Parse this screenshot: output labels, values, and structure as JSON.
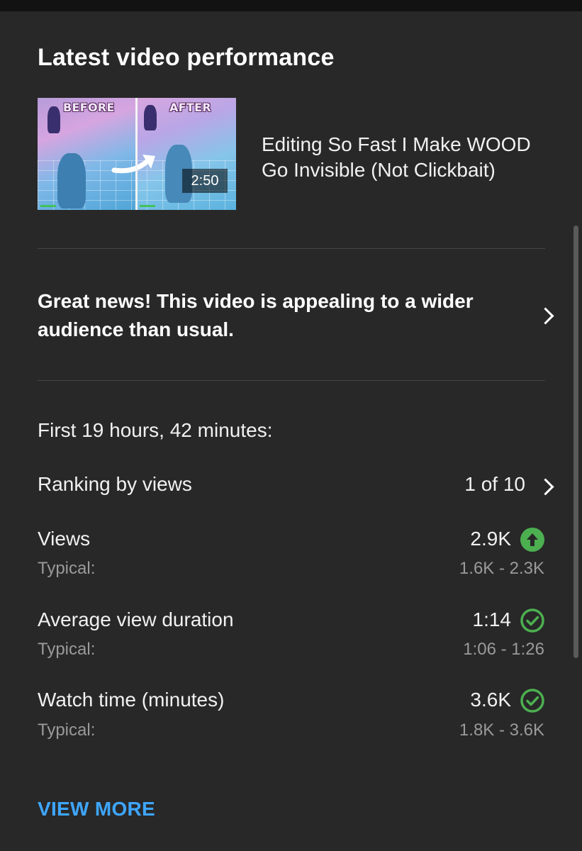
{
  "card": {
    "title": "Latest video performance"
  },
  "video": {
    "title": "Editing So Fast I Make WOOD Go Invisible (Not Clickbait)",
    "duration": "2:50",
    "thumbnail_before_label": "BEFORE",
    "thumbnail_after_label": "AFTER"
  },
  "insight": {
    "text": "Great news! This video is appealing to a wider audience than usual."
  },
  "period": {
    "label": "First 19 hours, 42 minutes:"
  },
  "ranking": {
    "label": "Ranking by views",
    "value": "1 of 10"
  },
  "metrics": [
    {
      "label": "Views",
      "value": "2.9K",
      "typical_label": "Typical:",
      "typical_range": "1.6K - 2.3K",
      "status_icon": "arrow-up-circle-icon"
    },
    {
      "label": "Average view duration",
      "value": "1:14",
      "typical_label": "Typical:",
      "typical_range": "1:06 - 1:26",
      "status_icon": "check-circle-icon"
    },
    {
      "label": "Watch time (minutes)",
      "value": "3.6K",
      "typical_label": "Typical:",
      "typical_range": "1.8K - 3.6K",
      "status_icon": "check-circle-icon"
    }
  ],
  "footer": {
    "view_more_label": "VIEW MORE"
  },
  "colors": {
    "background": "#282828",
    "status_green": "#4caf50",
    "link_blue": "#3ea6ff",
    "secondary_text": "#9a9a9a"
  }
}
